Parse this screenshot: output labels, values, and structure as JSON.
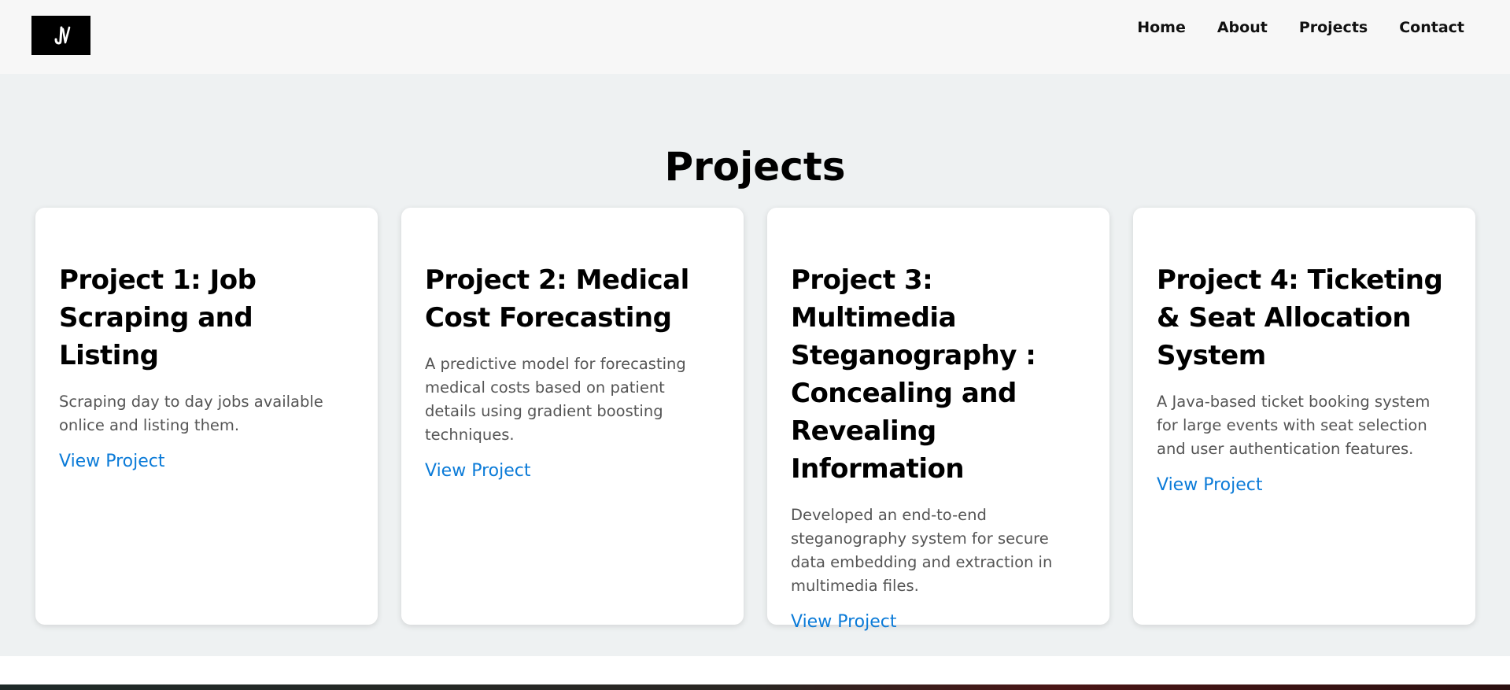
{
  "nav": {
    "links": [
      "Home",
      "About",
      "Projects",
      "Contact"
    ]
  },
  "section": {
    "title": "Projects"
  },
  "projects": [
    {
      "title": "Project 1: Job Scraping and Listing",
      "description": "Scraping day to day jobs available onlice and listing them.",
      "link": "View Project"
    },
    {
      "title": "Project 2: Medical Cost Forecasting",
      "description": "A predictive model for forecasting medical costs based on patient details using gradient boosting techniques.",
      "link": "View Project"
    },
    {
      "title": "Project 3: Multimedia Steganography : Concealing and Revealing Information",
      "description": "Developed an end-to-end steganography system for secure data embedding and extraction in multimedia files.",
      "link": "View Project"
    },
    {
      "title": "Project 4: Ticketing & Seat Allocation System",
      "description": "A Java-based ticket booking system for large events with seat selection and user authentication features.",
      "link": "View Project"
    }
  ],
  "colors": {
    "accent_link": "#0b7bd8",
    "navbar_bg": "#f7f7f7",
    "section_bg": "#eef1f2"
  }
}
